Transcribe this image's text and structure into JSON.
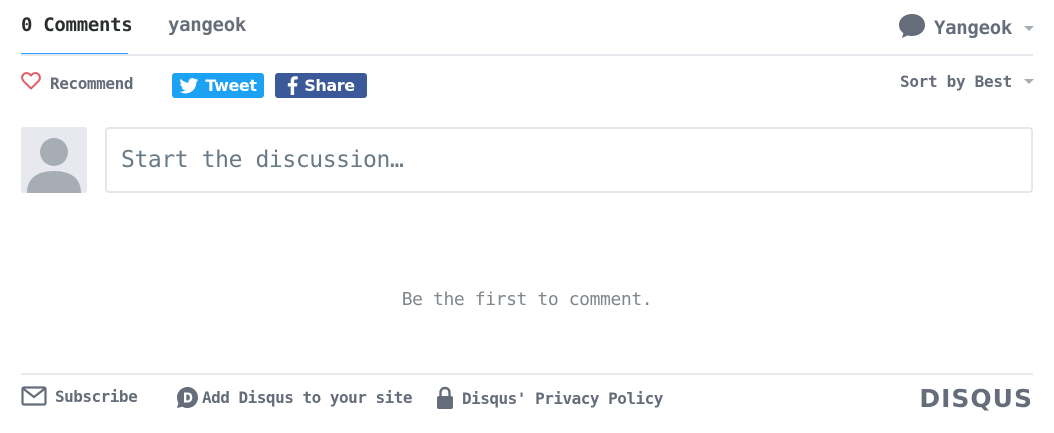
{
  "tabs": {
    "comments_label": "0 Comments",
    "forum_label": "yangeok"
  },
  "user": {
    "name": "Yangeok"
  },
  "actions": {
    "recommend_label": "Recommend",
    "tweet_label": "Tweet",
    "share_label": "Share",
    "sort_label": "Sort by Best"
  },
  "composer": {
    "placeholder": "Start the discussion…"
  },
  "empty_state": {
    "message": "Be the first to comment."
  },
  "footer": {
    "subscribe_label": "Subscribe",
    "add_disqus_label": "Add Disqus to your site",
    "privacy_label": "Disqus' Privacy Policy",
    "brand": "DISQUS"
  },
  "colors": {
    "accent": "#2e9fff",
    "twitter": "#1da1f2",
    "facebook": "#3b5998",
    "heart": "#e35d6a",
    "text_muted": "#656c7a"
  },
  "icons": {
    "recommend": "heart-outline-icon",
    "tweet": "twitter-bird-icon",
    "share": "facebook-f-icon",
    "user": "speech-bubble-avatar-icon",
    "subscribe": "envelope-icon",
    "add_disqus": "disqus-d-icon",
    "privacy": "padlock-icon"
  }
}
